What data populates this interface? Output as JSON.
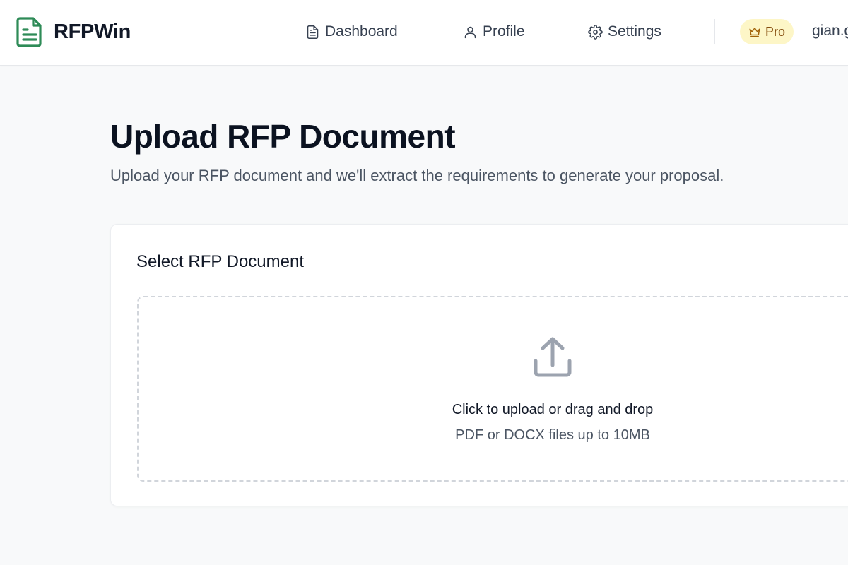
{
  "app": {
    "name": "RFPWin",
    "icon": "document-icon",
    "brand_color": "#2e8b57"
  },
  "nav": {
    "items": [
      {
        "label": "Dashboard",
        "icon": "file-text-icon"
      },
      {
        "label": "Profile",
        "icon": "user-icon"
      },
      {
        "label": "Settings",
        "icon": "gear-icon"
      }
    ]
  },
  "account": {
    "plan_label": "Pro",
    "plan_icon": "crown-icon",
    "plan_color": "#854d0e",
    "user_email": "gian.g"
  },
  "page": {
    "title": "Upload RFP Document",
    "subtitle": "Upload your RFP document and we'll extract the requirements to generate your proposal."
  },
  "upload_card": {
    "title": "Select RFP Document",
    "icon": "upload-icon",
    "primary_text": "Click to upload or drag and drop",
    "secondary_text": "PDF or DOCX files up to 10MB"
  }
}
